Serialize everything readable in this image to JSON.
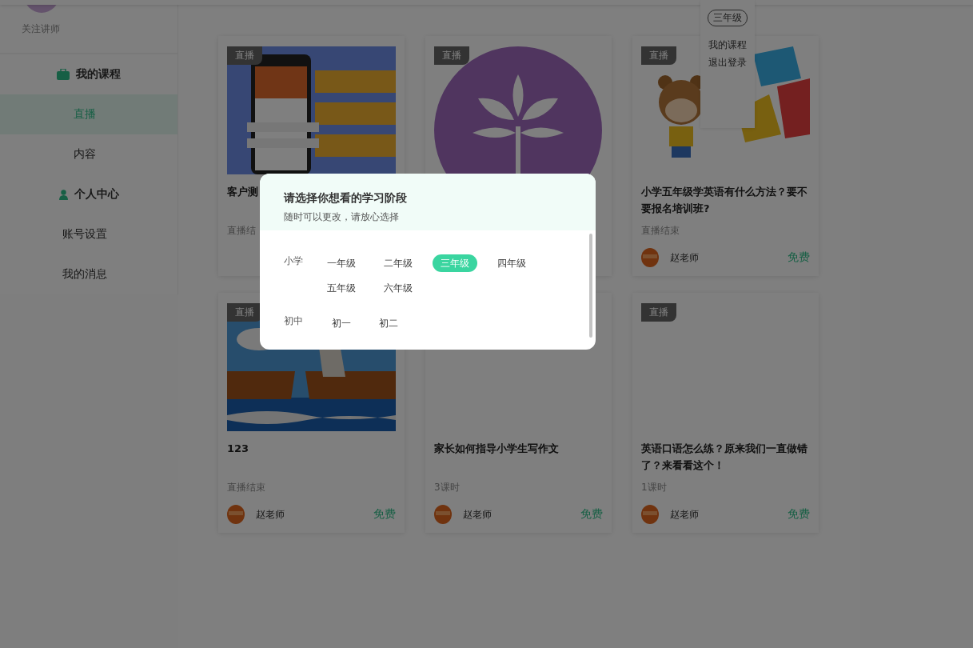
{
  "sidebar": {
    "follow": "关注讲师",
    "items": [
      {
        "kind": "group",
        "label": "我的课程",
        "selected": false
      },
      {
        "kind": "link",
        "label": "直播",
        "selected": true
      },
      {
        "kind": "link",
        "label": "内容",
        "selected": false
      },
      {
        "kind": "group",
        "label": "个人中心",
        "selected": false
      },
      {
        "kind": "link",
        "label": "账号设置",
        "selected": false
      },
      {
        "kind": "link",
        "label": "我的消息",
        "selected": false
      }
    ]
  },
  "user_menu": {
    "grade": "三年级",
    "items": [
      "我的课程",
      "退出登录"
    ]
  },
  "cards": [
    {
      "badge": "直播",
      "title": "客户测",
      "meta": "直播结"
    },
    {
      "badge": "直播"
    },
    {
      "badge": "直播",
      "title": "小学五年级学英语有什么方法？要不要报名培训班?",
      "meta": "直播结束",
      "author": "赵老师",
      "price": "免费"
    },
    {
      "badge": "直播",
      "title": "123",
      "meta": "直播结束",
      "author": "赵老师",
      "price": "免费"
    },
    {
      "title": "家长如何指导小学生写作文",
      "meta": "3课时",
      "author": "赵老师",
      "price": "免费"
    },
    {
      "badge": "直播",
      "title": "英语口语怎么练？原来我们一直做错了？来看看这个！",
      "meta": "1课时",
      "author": "赵老师",
      "price": "免费"
    }
  ],
  "dialog": {
    "title": "请选择你想看的学习阶段",
    "subtitle": "随时可以更改，请放心选择",
    "sections": [
      {
        "label": "小学",
        "options": [
          {
            "label": "一年级",
            "selected": false
          },
          {
            "label": "二年级",
            "selected": false
          },
          {
            "label": "三年级",
            "selected": true
          },
          {
            "label": "四年级",
            "selected": false
          },
          {
            "label": "五年级",
            "selected": false
          },
          {
            "label": "六年级",
            "selected": false
          }
        ]
      },
      {
        "label": "初中",
        "options": [
          {
            "label": "初一",
            "selected": false
          },
          {
            "label": "初二",
            "selected": false
          }
        ]
      }
    ]
  }
}
